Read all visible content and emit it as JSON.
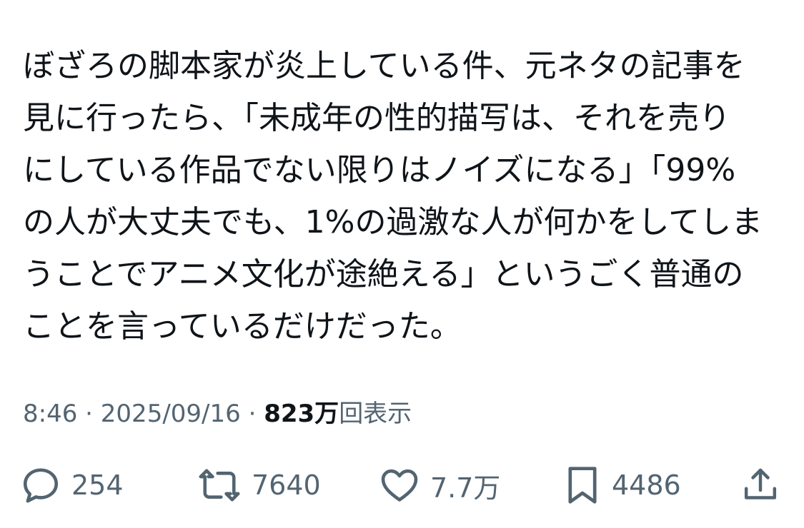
{
  "tweet": {
    "lines": [
      "ぼざろの脚本家が炎上している件、元ネタの記事を",
      "見に行ったら、「未成年の性的描写は、それを売り",
      "にしている作品でない限りはノイズになる」「99%",
      "の人が大丈夫でも、1%の過激な人が何かをしてしま",
      "うことでアニメ文化が途絶える」というごく普通の",
      "ことを言っているだけだった。"
    ]
  },
  "meta": {
    "time": "8:46",
    "separator1": " · ",
    "date": "2025/09/16",
    "separator2": " · ",
    "views_count": "823万",
    "views_label": "回表示"
  },
  "actions": {
    "reply": {
      "icon": "reply-icon",
      "count": "254"
    },
    "retweet": {
      "icon": "retweet-icon",
      "count": "7640"
    },
    "like": {
      "icon": "heart-icon",
      "count": "7.7万"
    },
    "bookmark": {
      "icon": "bookmark-icon",
      "count": "4486"
    },
    "share": {
      "icon": "share-icon"
    }
  },
  "colors": {
    "text": "#0f1419",
    "secondary": "#536471",
    "background": "#ffffff"
  }
}
